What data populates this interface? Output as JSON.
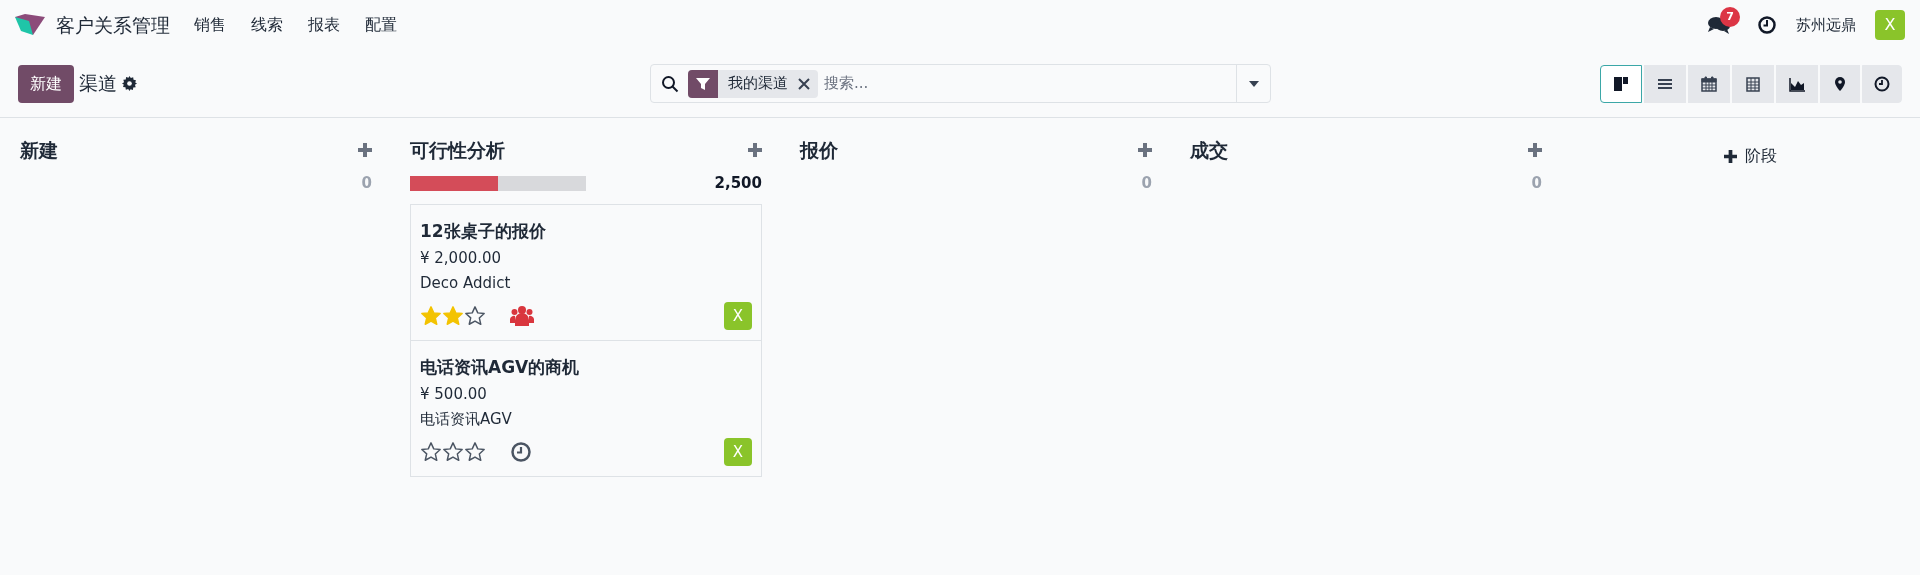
{
  "navbar": {
    "app_title": "客户关系管理",
    "menu": [
      "销售",
      "线索",
      "报表",
      "配置"
    ],
    "messages_badge": "7",
    "company": "苏州远鼎",
    "user_avatar": "X"
  },
  "control_panel": {
    "new_button": "新建",
    "breadcrumb": "渠道",
    "search": {
      "facets": [
        {
          "label": "我的渠道"
        }
      ],
      "placeholder": "搜索..."
    },
    "views": [
      {
        "kind": "kanban",
        "selected": true
      },
      {
        "kind": "list",
        "selected": false
      },
      {
        "kind": "calendar",
        "selected": false
      },
      {
        "kind": "pivot",
        "selected": false
      },
      {
        "kind": "graph",
        "selected": false
      },
      {
        "kind": "map",
        "selected": false
      },
      {
        "kind": "activity",
        "selected": false
      }
    ]
  },
  "columns": [
    {
      "title": "新建",
      "total": "0"
    },
    {
      "title": "可行性分析",
      "total": "2,500",
      "level": 0.5,
      "cards": [
        {
          "title": "12张桌子的报价",
          "amount": "¥ 2,000.00",
          "customer": "Deco Addict",
          "stars": 2,
          "activity": {
            "kind": "people",
            "color": "#d9363e"
          },
          "avatar": "X"
        },
        {
          "title": "电话资讯AGV的商机",
          "amount": "¥ 500.00",
          "customer": "电话资讯AGV",
          "stars": 0,
          "activity": {
            "kind": "clock",
            "color": "#4b5563"
          },
          "avatar": "X"
        }
      ]
    },
    {
      "title": "报价",
      "total": "0"
    },
    {
      "title": "成交",
      "total": "0"
    }
  ],
  "add_stage": "阶段"
}
